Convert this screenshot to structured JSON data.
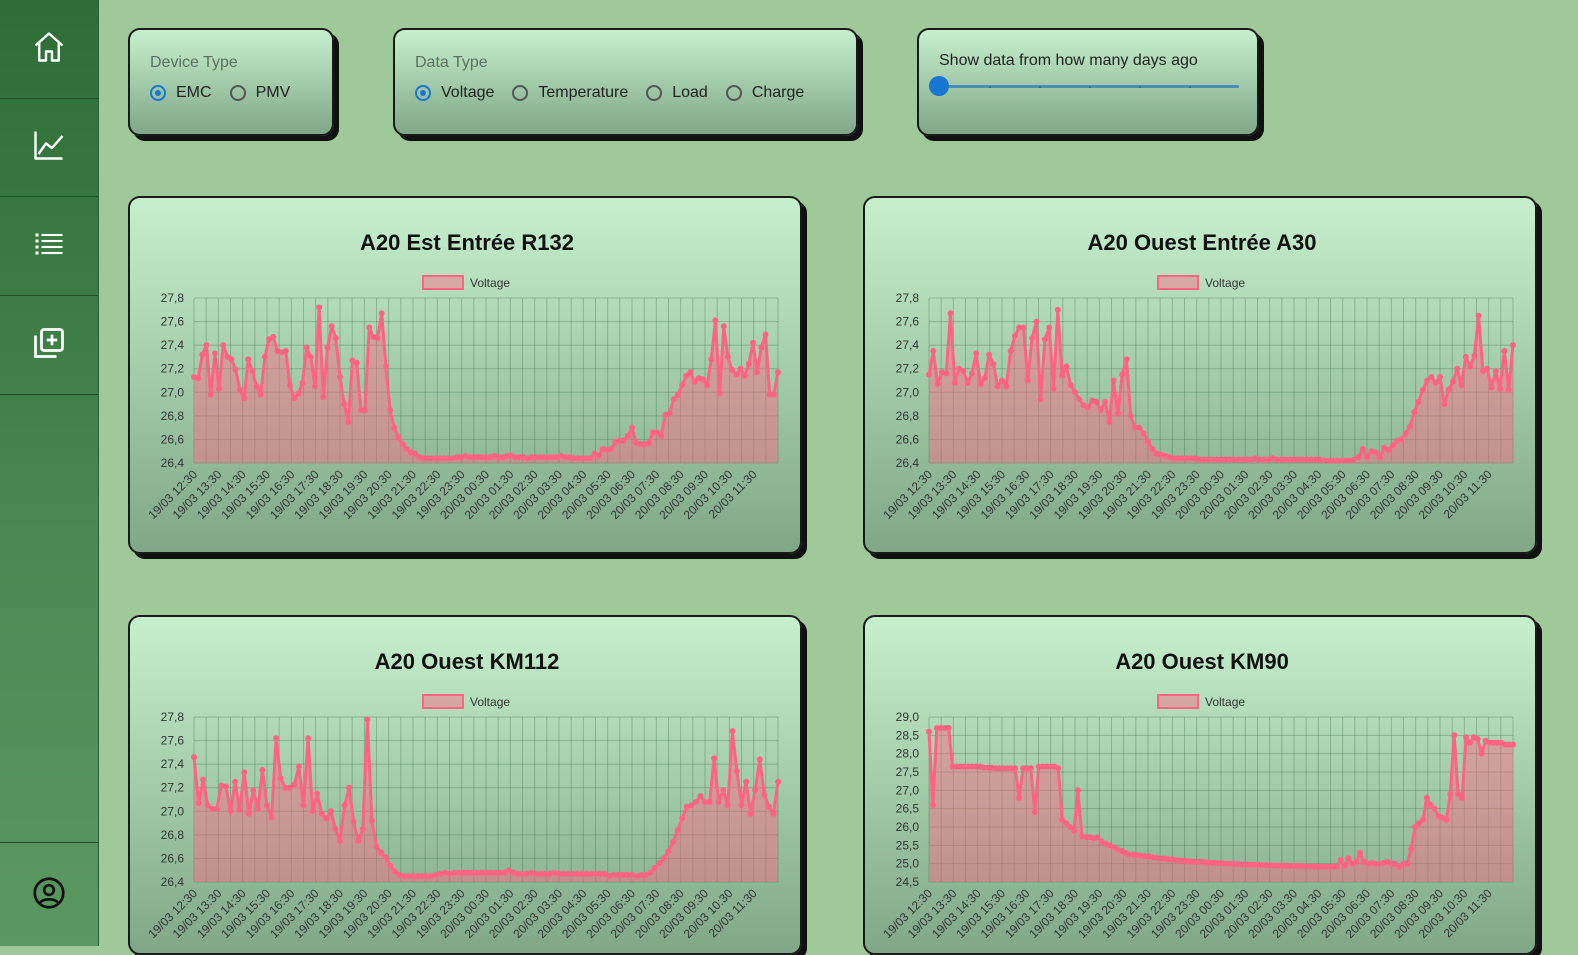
{
  "sidebar": {
    "items": [
      {
        "icon": "home-icon"
      },
      {
        "icon": "chart-line-icon"
      },
      {
        "icon": "list-icon"
      },
      {
        "icon": "add-copy-icon"
      }
    ],
    "bottom_icon": "account-circle-icon",
    "accent": "#2c6e36"
  },
  "filters": {
    "device_type": {
      "label": "Device Type",
      "options": [
        "EMC",
        "PMV"
      ],
      "selected": "EMC"
    },
    "data_type": {
      "label": "Data Type",
      "options": [
        "Voltage",
        "Temperature",
        "Load",
        "Charge"
      ],
      "selected": "Voltage"
    },
    "days": {
      "label": "Show data from how many days ago",
      "value": 0,
      "min": 0,
      "max": 6
    }
  },
  "chart_data": [
    {
      "type": "area",
      "title": "A20 Est Entrée R132",
      "series": [
        {
          "name": "Voltage",
          "values": [
            27.13,
            27.12,
            27.32,
            27.4,
            26.98,
            27.33,
            27.03,
            27.4,
            27.3,
            27.28,
            27.19,
            27.02,
            26.95,
            27.28,
            27.18,
            27.05,
            26.98,
            27.3,
            27.45,
            27.47,
            27.35,
            27.34,
            27.35,
            27.06,
            26.95,
            26.99,
            27.08,
            27.38,
            27.3,
            27.05,
            27.72,
            26.96,
            27.38,
            27.56,
            27.46,
            27.13,
            26.9,
            26.75,
            27.27,
            27.25,
            26.85,
            26.85,
            27.55,
            27.47,
            27.46,
            27.67,
            27.22,
            26.85,
            26.7,
            26.62,
            26.56,
            26.52,
            26.49,
            26.48,
            26.45,
            26.44,
            26.44,
            26.44,
            26.44,
            26.44,
            26.44,
            26.44,
            26.44,
            26.45,
            26.45,
            26.46,
            26.45,
            26.45,
            26.45,
            26.45,
            26.45,
            26.45,
            26.46,
            26.45,
            26.45,
            26.46,
            26.46,
            26.45,
            26.45,
            26.45,
            26.44,
            26.45,
            26.45,
            26.45,
            26.45,
            26.45,
            26.45,
            26.45,
            26.46,
            26.45,
            26.45,
            26.44,
            26.44,
            26.44,
            26.44,
            26.44,
            26.48,
            26.46,
            26.52,
            26.51,
            26.52,
            26.58,
            26.59,
            26.59,
            26.63,
            26.7,
            26.57,
            26.56,
            26.56,
            26.57,
            26.66,
            26.66,
            26.63,
            26.81,
            26.82,
            26.94,
            26.98,
            27.06,
            27.14,
            27.17,
            27.09,
            27.12,
            27.11,
            27.06,
            27.28,
            27.61,
            26.99,
            27.56,
            27.3,
            27.19,
            27.15,
            27.2,
            27.14,
            27.24,
            27.42,
            27.17,
            27.38,
            27.49,
            26.98,
            26.98,
            27.17
          ]
        }
      ],
      "ylim": [
        26.4,
        27.8
      ],
      "yticks": [
        "27,8",
        "27,6",
        "27,4",
        "27,2",
        "27,0",
        "26,8",
        "26,6",
        "26,4"
      ]
    },
    {
      "type": "area",
      "title": "A20 Ouest Entrée A30",
      "series": [
        {
          "name": "Voltage",
          "values": [
            27.15,
            27.35,
            27.07,
            27.17,
            27.16,
            27.67,
            27.08,
            27.2,
            27.18,
            27.08,
            27.16,
            27.33,
            27.07,
            27.12,
            27.32,
            27.24,
            27.05,
            27.1,
            27.05,
            27.35,
            27.48,
            27.55,
            27.55,
            27.1,
            27.46,
            27.6,
            26.94,
            27.45,
            27.55,
            27.03,
            27.7,
            27.14,
            27.22,
            27.06,
            27.0,
            26.94,
            26.89,
            26.87,
            26.93,
            26.92,
            26.85,
            26.92,
            26.75,
            27.1,
            26.82,
            27.15,
            27.28,
            26.8,
            26.7,
            26.7,
            26.65,
            26.58,
            26.52,
            26.48,
            26.47,
            26.46,
            26.45,
            26.44,
            26.44,
            26.44,
            26.44,
            26.44,
            26.44,
            26.43,
            26.43,
            26.43,
            26.43,
            26.43,
            26.43,
            26.43,
            26.43,
            26.43,
            26.43,
            26.43,
            26.43,
            26.43,
            26.44,
            26.43,
            26.43,
            26.43,
            26.44,
            26.43,
            26.43,
            26.43,
            26.43,
            26.43,
            26.43,
            26.43,
            26.43,
            26.43,
            26.43,
            26.43,
            26.42,
            26.42,
            26.42,
            26.42,
            26.42,
            26.42,
            26.42,
            26.43,
            26.45,
            26.52,
            26.45,
            26.5,
            26.49,
            26.45,
            26.53,
            26.51,
            26.55,
            26.59,
            26.6,
            26.65,
            26.71,
            26.83,
            26.92,
            27.02,
            27.1,
            27.13,
            27.08,
            27.13,
            26.9,
            27.02,
            27.09,
            27.2,
            27.06,
            27.3,
            27.22,
            27.31,
            27.65,
            27.18,
            27.2,
            27.04,
            27.18,
            27.03,
            27.35,
            27.02,
            27.4
          ]
        }
      ],
      "ylim": [
        26.4,
        27.8
      ],
      "yticks": [
        "27,8",
        "27,6",
        "27,4",
        "27,2",
        "27,0",
        "26,8",
        "26,6",
        "26,4"
      ]
    },
    {
      "type": "area",
      "title": "A20 Ouest KM112",
      "series": [
        {
          "name": "Voltage",
          "values": [
            27.46,
            27.07,
            27.27,
            27.05,
            27.02,
            27.02,
            27.22,
            27.21,
            27.0,
            27.25,
            27.01,
            27.33,
            26.98,
            27.18,
            27.02,
            27.35,
            27.05,
            26.95,
            27.62,
            27.28,
            27.2,
            27.2,
            27.23,
            27.38,
            27.05,
            27.62,
            27.0,
            27.15,
            26.98,
            26.94,
            27.0,
            26.85,
            26.75,
            27.05,
            27.2,
            26.91,
            26.75,
            26.85,
            27.78,
            26.92,
            26.7,
            26.65,
            26.61,
            26.54,
            26.49,
            26.46,
            26.45,
            26.45,
            26.45,
            26.45,
            26.45,
            26.45,
            26.45,
            26.46,
            26.47,
            26.48,
            26.47,
            26.48,
            26.48,
            26.48,
            26.48,
            26.48,
            26.48,
            26.48,
            26.48,
            26.48,
            26.48,
            26.48,
            26.48,
            26.5,
            26.48,
            26.47,
            26.47,
            26.47,
            26.48,
            26.47,
            26.47,
            26.47,
            26.47,
            26.48,
            26.47,
            26.47,
            26.47,
            26.47,
            26.47,
            26.47,
            26.47,
            26.47,
            26.47,
            26.47,
            26.47,
            26.45,
            26.46,
            26.46,
            26.46,
            26.46,
            26.46,
            26.45,
            26.46,
            26.46,
            26.48,
            26.52,
            26.56,
            26.6,
            26.66,
            26.74,
            26.84,
            26.94,
            27.04,
            27.05,
            27.08,
            27.13,
            27.08,
            27.08,
            27.45,
            27.08,
            27.18,
            27.05,
            27.68,
            27.34,
            27.05,
            27.25,
            26.98,
            27.18,
            27.44,
            27.14,
            27.04,
            26.98,
            27.25
          ]
        }
      ],
      "ylim": [
        26.4,
        27.8
      ],
      "yticks": [
        "27,8",
        "27,6",
        "27,4",
        "27,2",
        "27,0",
        "26,8",
        "26,6",
        "26,4"
      ]
    },
    {
      "type": "area",
      "title": "A20 Ouest KM90",
      "series": [
        {
          "name": "Voltage",
          "values": [
            28.6,
            26.6,
            28.7,
            28.7,
            28.7,
            28.7,
            27.65,
            27.65,
            27.65,
            27.65,
            27.65,
            27.65,
            27.65,
            27.65,
            27.62,
            27.62,
            27.62,
            27.6,
            27.6,
            27.6,
            27.6,
            27.6,
            27.6,
            26.8,
            27.6,
            27.6,
            27.6,
            26.4,
            27.65,
            27.65,
            27.65,
            27.65,
            27.65,
            27.6,
            26.2,
            26.1,
            26.0,
            25.9,
            27.0,
            25.75,
            25.72,
            25.72,
            25.7,
            25.72,
            25.6,
            25.55,
            25.5,
            25.45,
            25.4,
            25.35,
            25.3,
            25.25,
            25.25,
            25.23,
            25.22,
            25.2,
            25.2,
            25.18,
            25.16,
            25.15,
            25.14,
            25.12,
            25.12,
            25.1,
            25.09,
            25.08,
            25.07,
            25.06,
            25.05,
            25.05,
            25.04,
            25.03,
            25.03,
            25.02,
            25.01,
            25.01,
            25.0,
            25.0,
            24.99,
            24.99,
            24.98,
            24.98,
            24.97,
            24.97,
            24.97,
            24.96,
            24.96,
            24.96,
            24.95,
            24.95,
            24.95,
            24.94,
            24.94,
            24.94,
            24.94,
            24.93,
            24.93,
            24.93,
            24.93,
            24.92,
            24.92,
            24.92,
            24.92,
            24.92,
            24.92,
            25.1,
            24.95,
            25.15,
            25.0,
            25.05,
            25.3,
            25.05,
            25.0,
            25.02,
            25.0,
            25.0,
            25.02,
            25.05,
            25.0,
            25.0,
            24.9,
            25.0,
            25.0,
            25.4,
            26.0,
            26.1,
            26.2,
            26.8,
            26.6,
            26.5,
            26.3,
            26.25,
            26.2,
            26.9,
            28.5,
            26.9,
            26.8,
            28.45,
            28.3,
            28.45,
            28.4,
            28.0,
            28.35,
            28.3,
            28.3,
            28.3,
            28.3,
            28.25,
            28.25,
            28.25
          ]
        }
      ],
      "ylim": [
        24.5,
        29.0
      ],
      "yticks": [
        "29,0",
        "28,5",
        "28,0",
        "27,5",
        "27,0",
        "26,5",
        "26,0",
        "25,5",
        "25,0",
        "24,5"
      ]
    }
  ],
  "xticks": [
    "19/03 12:30",
    "19/03 13:30",
    "19/03 14:30",
    "19/03 15:30",
    "19/03 16:30",
    "19/03 17:30",
    "19/03 18:30",
    "19/03 19:30",
    "19/03 20:30",
    "19/03 21:30",
    "19/03 22:30",
    "19/03 23:30",
    "20/03 00:30",
    "20/03 01:30",
    "20/03 02:30",
    "20/03 03:30",
    "20/03 04:30",
    "20/03 05:30",
    "20/03 06:30",
    "20/03 07:30",
    "20/03 08:30",
    "20/03 09:30",
    "20/03 10:30",
    "20/03 11:30"
  ],
  "colors": {
    "series_line": "#ff6384",
    "series_fill": "rgba(255,99,132,0.45)",
    "grid": "rgba(60,110,70,0.35)"
  }
}
